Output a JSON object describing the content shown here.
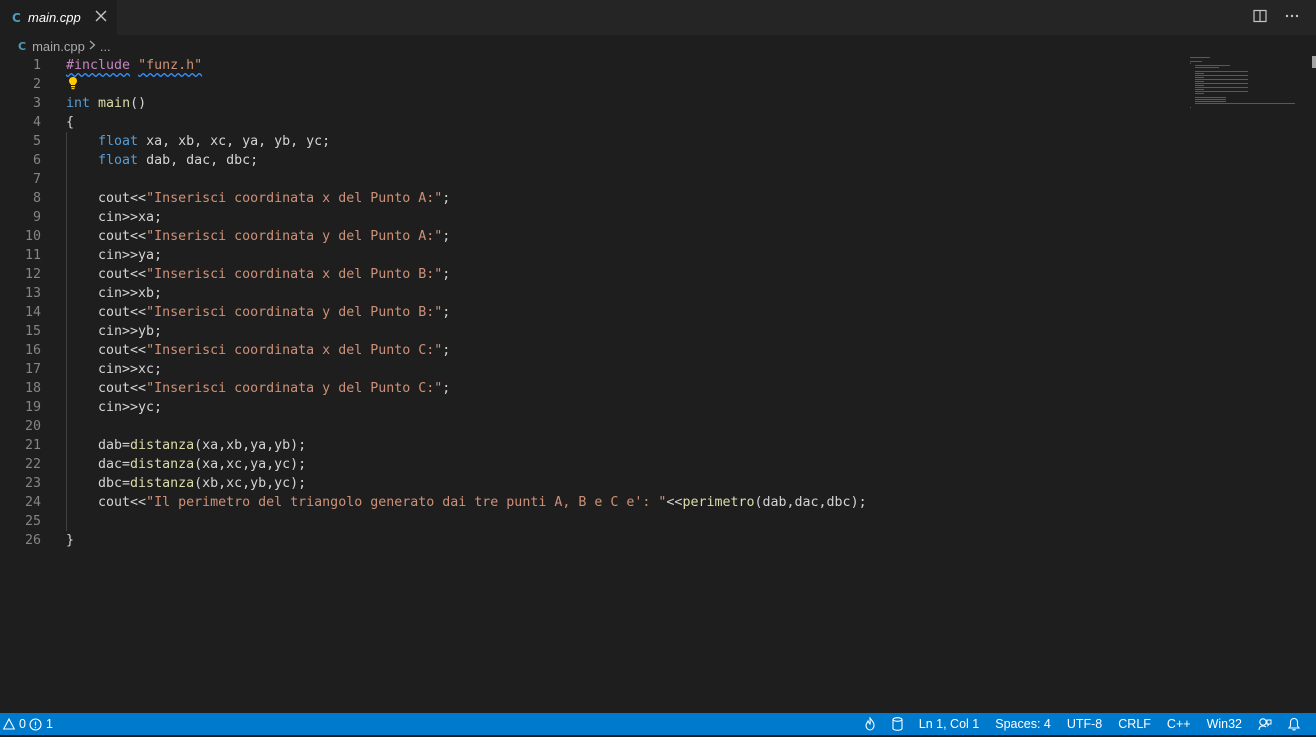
{
  "tab": {
    "icon": "cpp-file-icon",
    "icon_glyph": "C",
    "title": "main.cpp"
  },
  "breadcrumb": {
    "file": "main.cpp",
    "rest": "..."
  },
  "code_lines": [
    {
      "n": "1",
      "tokens": [
        {
          "t": "#include",
          "c": "pp squig"
        },
        {
          "t": " ",
          "c": ""
        },
        {
          "t": "\"funz.h\"",
          "c": "str squig"
        }
      ]
    },
    {
      "n": "2",
      "tokens": []
    },
    {
      "n": "3",
      "tokens": [
        {
          "t": "int",
          "c": "kw"
        },
        {
          "t": " ",
          "c": ""
        },
        {
          "t": "main",
          "c": "fn"
        },
        {
          "t": "()",
          "c": ""
        }
      ]
    },
    {
      "n": "4",
      "tokens": [
        {
          "t": "{",
          "c": ""
        }
      ]
    },
    {
      "n": "5",
      "tokens": [
        {
          "t": "    ",
          "c": ""
        },
        {
          "t": "float",
          "c": "kw"
        },
        {
          "t": " xa, xb, xc, ya, yb, yc;",
          "c": ""
        }
      ]
    },
    {
      "n": "6",
      "tokens": [
        {
          "t": "    ",
          "c": ""
        },
        {
          "t": "float",
          "c": "kw"
        },
        {
          "t": " dab, dac, dbc;",
          "c": ""
        }
      ]
    },
    {
      "n": "7",
      "tokens": []
    },
    {
      "n": "8",
      "tokens": [
        {
          "t": "    cout<<",
          "c": ""
        },
        {
          "t": "\"Inserisci coordinata x del Punto A:\"",
          "c": "str"
        },
        {
          "t": ";",
          "c": ""
        }
      ]
    },
    {
      "n": "9",
      "tokens": [
        {
          "t": "    cin>>xa;",
          "c": ""
        }
      ]
    },
    {
      "n": "10",
      "tokens": [
        {
          "t": "    cout<<",
          "c": ""
        },
        {
          "t": "\"Inserisci coordinata y del Punto A:\"",
          "c": "str"
        },
        {
          "t": ";",
          "c": ""
        }
      ]
    },
    {
      "n": "11",
      "tokens": [
        {
          "t": "    cin>>ya;",
          "c": ""
        }
      ]
    },
    {
      "n": "12",
      "tokens": [
        {
          "t": "    cout<<",
          "c": ""
        },
        {
          "t": "\"Inserisci coordinata x del Punto B:\"",
          "c": "str"
        },
        {
          "t": ";",
          "c": ""
        }
      ]
    },
    {
      "n": "13",
      "tokens": [
        {
          "t": "    cin>>xb;",
          "c": ""
        }
      ]
    },
    {
      "n": "14",
      "tokens": [
        {
          "t": "    cout<<",
          "c": ""
        },
        {
          "t": "\"Inserisci coordinata y del Punto B:\"",
          "c": "str"
        },
        {
          "t": ";",
          "c": ""
        }
      ]
    },
    {
      "n": "15",
      "tokens": [
        {
          "t": "    cin>>yb;",
          "c": ""
        }
      ]
    },
    {
      "n": "16",
      "tokens": [
        {
          "t": "    cout<<",
          "c": ""
        },
        {
          "t": "\"Inserisci coordinata x del Punto C:\"",
          "c": "str"
        },
        {
          "t": ";",
          "c": ""
        }
      ]
    },
    {
      "n": "17",
      "tokens": [
        {
          "t": "    cin>>xc;",
          "c": ""
        }
      ]
    },
    {
      "n": "18",
      "tokens": [
        {
          "t": "    cout<<",
          "c": ""
        },
        {
          "t": "\"Inserisci coordinata y del Punto C:\"",
          "c": "str"
        },
        {
          "t": ";",
          "c": ""
        }
      ]
    },
    {
      "n": "19",
      "tokens": [
        {
          "t": "    cin>>yc;",
          "c": ""
        }
      ]
    },
    {
      "n": "20",
      "tokens": []
    },
    {
      "n": "21",
      "tokens": [
        {
          "t": "    dab=",
          "c": ""
        },
        {
          "t": "distanza",
          "c": "fn"
        },
        {
          "t": "(xa,xb,ya,yb);",
          "c": ""
        }
      ]
    },
    {
      "n": "22",
      "tokens": [
        {
          "t": "    dac=",
          "c": ""
        },
        {
          "t": "distanza",
          "c": "fn"
        },
        {
          "t": "(xa,xc,ya,yc);",
          "c": ""
        }
      ]
    },
    {
      "n": "23",
      "tokens": [
        {
          "t": "    dbc=",
          "c": ""
        },
        {
          "t": "distanza",
          "c": "fn"
        },
        {
          "t": "(xb,xc,yb,yc);",
          "c": ""
        }
      ]
    },
    {
      "n": "24",
      "tokens": [
        {
          "t": "    cout<<",
          "c": ""
        },
        {
          "t": "\"Il perimetro del triangolo generato dai tre punti A, B e C e': \"",
          "c": "str"
        },
        {
          "t": "<<",
          "c": ""
        },
        {
          "t": "perimetro",
          "c": "fn"
        },
        {
          "t": "(dab,dac,dbc);",
          "c": ""
        }
      ]
    },
    {
      "n": "25",
      "tokens": []
    },
    {
      "n": "26",
      "tokens": [
        {
          "t": "}",
          "c": ""
        }
      ]
    }
  ],
  "lightbulb_line": "2",
  "status": {
    "warnings": "0",
    "errors": "1",
    "cursor": "Ln 1, Col 1",
    "spaces": "Spaces: 4",
    "encoding": "UTF-8",
    "eol": "CRLF",
    "language": "C++",
    "platform": "Win32"
  },
  "colors": {
    "editor_bg": "#1e1e1e",
    "statusbar_bg": "#007acc",
    "keyword": "#569cd6",
    "string": "#ce9178",
    "function": "#dcdcaa",
    "preprocessor": "#c586c0"
  }
}
